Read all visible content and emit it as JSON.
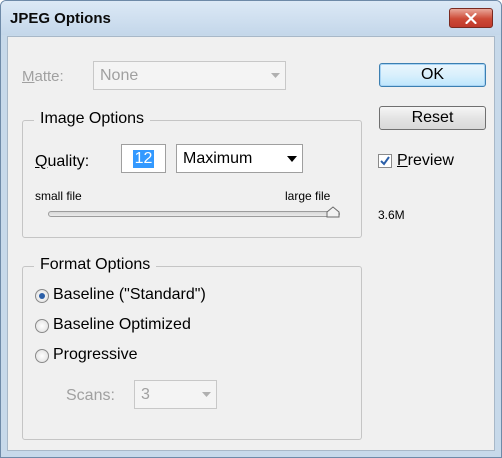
{
  "window": {
    "title": "JPEG Options"
  },
  "matte": {
    "label": "Matte:",
    "value": "None"
  },
  "image_options": {
    "title": "Image Options",
    "quality_label": "Quality:",
    "quality_value": "12",
    "quality_preset": "Maximum",
    "slider_min_label": "small file",
    "slider_max_label": "large file",
    "slider_level": 1.0
  },
  "format_options": {
    "title": "Format Options",
    "radios": [
      {
        "label": "Baseline (\"Standard\")",
        "checked": true
      },
      {
        "label": "Baseline Optimized",
        "checked": false
      },
      {
        "label": "Progressive",
        "checked": false
      }
    ],
    "scans_label": "Scans:",
    "scans_value": "3"
  },
  "buttons": {
    "ok": "OK",
    "reset": "Reset"
  },
  "preview": {
    "label": "Preview",
    "checked": true,
    "size": "3.6M"
  },
  "colors": {
    "accent": "#3399ff",
    "close_red": "#c0392b",
    "check_blue": "#2b5fa8"
  }
}
